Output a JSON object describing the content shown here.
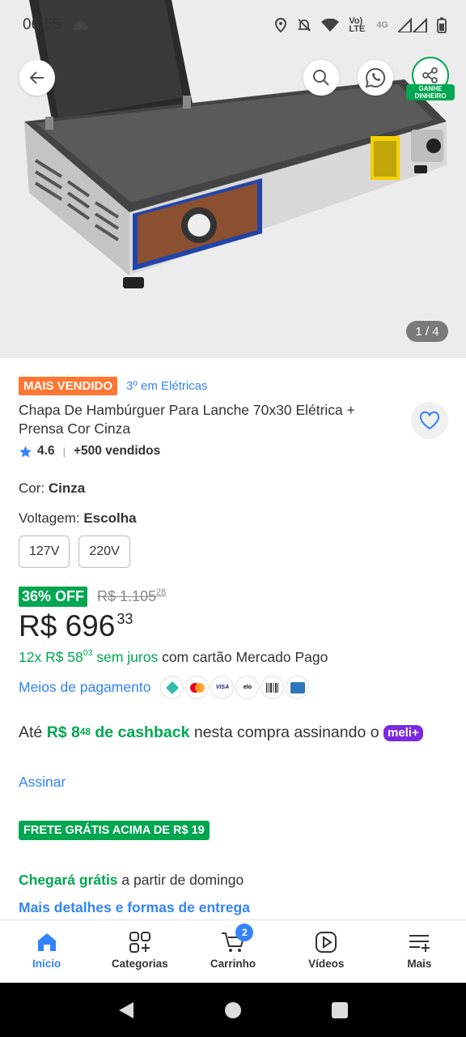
{
  "status_bar": {
    "time": "06:55",
    "network": "4G",
    "volte": "Vo) LTE"
  },
  "hero": {
    "pager": "1 / 4",
    "share_tag": "GANHE DINHEIRO"
  },
  "product": {
    "badge": "MAIS VENDIDO",
    "rank": "3º em Elétricas",
    "title": "Chapa De Hambúrguer Para Lanche 70x30 Elétrica + Prensa Cor Cinza",
    "rating": "4.6",
    "sold": "+500 vendidos"
  },
  "variations": {
    "color_label": "Cor:",
    "color_value": "Cinza",
    "voltage_label": "Voltagem:",
    "voltage_value": "Escolha",
    "options": [
      "127V",
      "220V"
    ]
  },
  "pricing": {
    "off": "36% OFF",
    "old_price_int": "R$ 1.105",
    "old_price_cents": "28",
    "price_int": "R$ 696",
    "price_cents": "33",
    "install_prefix": "12x R$ 58",
    "install_cents": "03",
    "install_suffix": "sem juros",
    "install_rest": "com cartão Mercado Pago",
    "payment_link": "Meios de pagamento",
    "payment_icons": [
      "pix",
      "mastercard",
      "visa",
      "elo",
      "boleto",
      "amex"
    ]
  },
  "cashback": {
    "prefix": "Até",
    "amount_int": "R$ 8",
    "amount_cents": "48",
    "label": "de cashback",
    "rest": "nesta compra assinando o",
    "brand": "meli+",
    "subscribe": "Assinar"
  },
  "shipping": {
    "banner": "FRETE GRÁTIS ACIMA DE R$ 19",
    "arrival_bold": "Chegará grátis",
    "arrival_rest": "a partir de domingo",
    "details": "Mais detalhes e formas de entrega"
  },
  "bottom_nav": {
    "items": [
      {
        "label": "Início"
      },
      {
        "label": "Categorias"
      },
      {
        "label": "Carrinho"
      },
      {
        "label": "Vídeos"
      },
      {
        "label": "Mais"
      }
    ],
    "cart_count": "2"
  },
  "colors": {
    "accent": "#3483fa",
    "green": "#00a650",
    "orange": "#ff7733",
    "meli": "#7b2ae0"
  }
}
